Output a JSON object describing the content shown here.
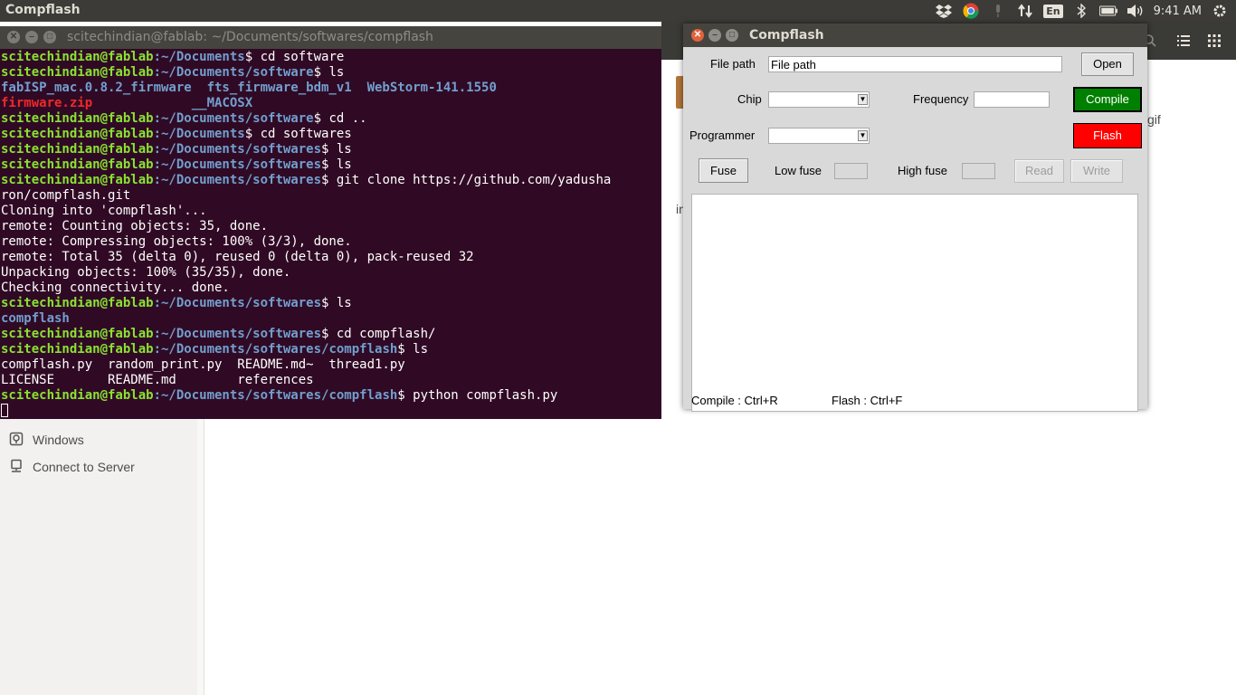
{
  "top_panel": {
    "app_name": "Compflash",
    "keyboard_layout": "En",
    "clock": "9:41 AM"
  },
  "terminal": {
    "title": "scitechindian@fablab: ~/Documents/softwares/compflash",
    "user_host": "scitechindian@fablab",
    "lines": [
      {
        "path": ":~/Documents",
        "cmd": "$ cd software"
      },
      {
        "path": ":~/Documents/software",
        "cmd": "$ ls"
      },
      {
        "out": "fabISP_mac.0.8.2_firmware  fts_firmware_bdm_v1  WebStorm-141.1550",
        "style": "d"
      },
      {
        "out_red": "firmware.zip",
        "out": "             __MACOSX"
      },
      {
        "path": ":~/Documents/software",
        "cmd": "$ cd .."
      },
      {
        "path": ":~/Documents",
        "cmd": "$ cd softwares"
      },
      {
        "path": ":~/Documents/softwares",
        "cmd": "$ ls"
      },
      {
        "path": ":~/Documents/softwares",
        "cmd": "$ ls"
      },
      {
        "path": ":~/Documents/softwares",
        "cmd": "$ git clone https://github.com/yadusha"
      },
      {
        "out": "ron/compflash.git"
      },
      {
        "out": "Cloning into 'compflash'..."
      },
      {
        "out": "remote: Counting objects: 35, done."
      },
      {
        "out": "remote: Compressing objects: 100% (3/3), done."
      },
      {
        "out": "remote: Total 35 (delta 0), reused 0 (delta 0), pack-reused 32"
      },
      {
        "out": "Unpacking objects: 100% (35/35), done."
      },
      {
        "out": "Checking connectivity... done."
      },
      {
        "path": ":~/Documents/softwares",
        "cmd": "$ ls"
      },
      {
        "out": "compflash",
        "style": "d"
      },
      {
        "path": ":~/Documents/softwares",
        "cmd": "$ cd compflash/"
      },
      {
        "path": ":~/Documents/softwares/compflash",
        "cmd": "$ ls"
      },
      {
        "out": "compflash.py  random_print.py  README.md~  thread1.py"
      },
      {
        "out": "LICENSE       README.md        references"
      },
      {
        "path": ":~/Documents/softwares/compflash",
        "cmd": "$ python compflash.py"
      }
    ]
  },
  "file_manager": {
    "sidebar_items": [
      {
        "label": "Windows",
        "icon": "windows-share-icon"
      },
      {
        "label": "Connect to Server",
        "icon": "server-icon"
      }
    ],
    "fragment_gif": "gif",
    "fragment_in": "in"
  },
  "dialog": {
    "title": "Compflash",
    "file_path_label": "File path",
    "file_path_value": "File path",
    "open_label": "Open",
    "chip_label": "Chip",
    "chip_value": "",
    "frequency_label": "Frequency",
    "frequency_value": "",
    "compile_label": "Compile",
    "programmer_label": "Programmer",
    "programmer_value": "",
    "flash_label": "Flash",
    "fuse_label": "Fuse",
    "low_fuse_label": "Low fuse",
    "high_fuse_label": "High fuse",
    "read_label": "Read",
    "write_label": "Write",
    "output_text": "",
    "status_compile": "Compile : Ctrl+R",
    "status_flash": "Flash : Ctrl+F",
    "colors": {
      "compile": "#008000",
      "flash": "#ff0000"
    }
  }
}
